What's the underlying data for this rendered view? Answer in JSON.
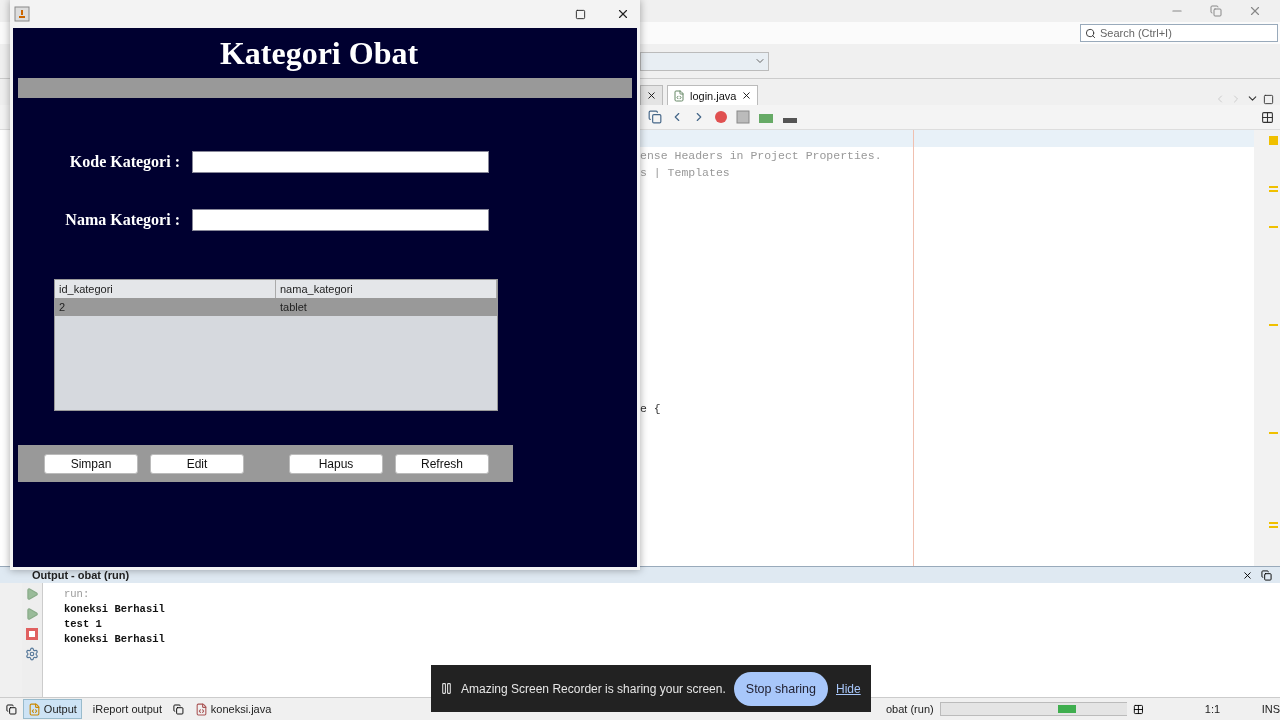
{
  "ide": {
    "search": {
      "placeholder": "Search (Ctrl+I)"
    },
    "editor_tabs": [
      {
        "label": "login.java",
        "selected": true
      }
    ],
    "header_comment": [
      "ense Headers in Project Properties.",
      "s | Templates"
    ],
    "class_line": "e {",
    "output": {
      "title": "Output - obat (run)",
      "lines": [
        {
          "text": "run:",
          "kind": "meta"
        },
        {
          "text": "koneksi Berhasil",
          "kind": "out"
        },
        {
          "text": "test 1",
          "kind": "out"
        },
        {
          "text": "koneksi Berhasil",
          "kind": "out"
        }
      ]
    },
    "status_bar": {
      "tabs": [
        {
          "label": "Output",
          "selected": true,
          "kind": "output"
        },
        {
          "label": "iReport output",
          "selected": false,
          "kind": "plain"
        },
        {
          "label": "koneksi.java",
          "selected": false,
          "kind": "file"
        }
      ],
      "task": "obat (run)",
      "position": "1:1",
      "mode": "INS"
    }
  },
  "dialog": {
    "title": "Kategori Obat",
    "fields": [
      {
        "label": "Kode Kategori :"
      },
      {
        "label": "Nama Kategori :"
      }
    ],
    "table": {
      "columns": [
        "id_kategori",
        "nama_kategori"
      ],
      "rows": [
        {
          "cells": [
            "2",
            "tablet"
          ],
          "selected": true
        }
      ]
    },
    "buttons": [
      "Simpan",
      "Edit",
      "Hapus",
      "Refresh"
    ]
  },
  "notification": {
    "message": "Amazing Screen Recorder is sharing your screen.",
    "button": "Stop sharing",
    "link": "Hide"
  }
}
